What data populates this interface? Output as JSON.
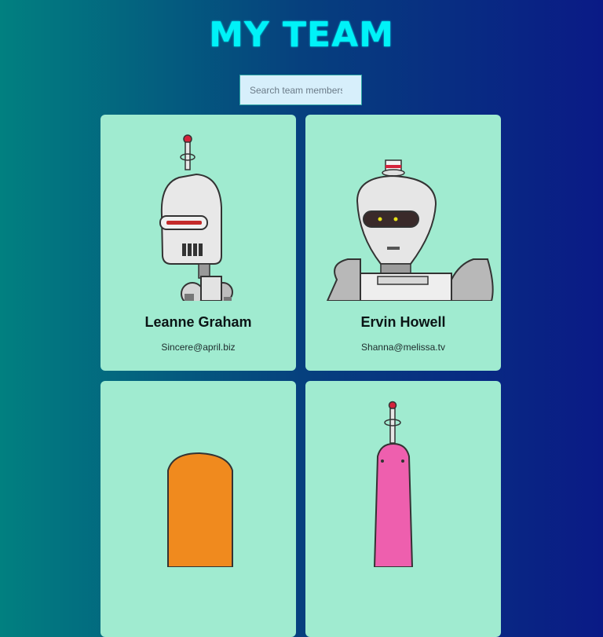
{
  "header": {
    "title": "MY TEAM"
  },
  "search": {
    "placeholder": "Search team members",
    "value": ""
  },
  "members": [
    {
      "name": "Leanne Graham",
      "email": "Sincere@april.biz",
      "avatar_icon": "robot-avatar-icon"
    },
    {
      "name": "Ervin Howell",
      "email": "Shanna@melissa.tv",
      "avatar_icon": "robot-avatar-icon"
    },
    {
      "name": "",
      "email": "",
      "avatar_icon": "robot-avatar-icon"
    },
    {
      "name": "",
      "email": "",
      "avatar_icon": "robot-avatar-icon"
    }
  ],
  "colors": {
    "title": "#00f2f8",
    "card": "#a0ebd0",
    "bg_start": "#018080",
    "bg_end": "#0a1a86"
  }
}
